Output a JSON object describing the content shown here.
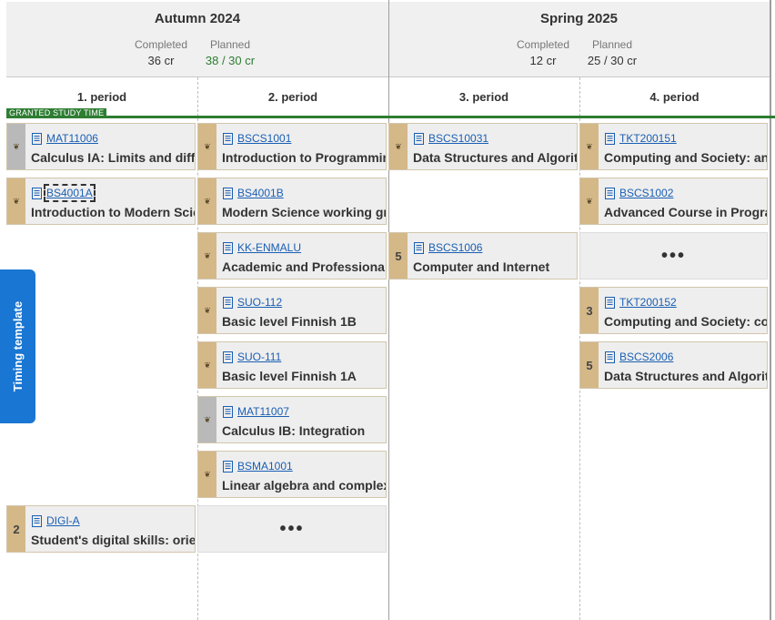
{
  "semesters": [
    {
      "title": "Autumn 2024",
      "completed_label": "Completed",
      "completed_value": "36 cr",
      "planned_label": "Planned",
      "planned_value": "38 / 30 cr"
    },
    {
      "title": "Spring 2025",
      "completed_label": "Completed",
      "completed_value": "12 cr",
      "planned_label": "Planned",
      "planned_value": "25 / 30 cr"
    }
  ],
  "periods": [
    "1. period",
    "2. period",
    "3. period",
    "4. period"
  ],
  "granted_label": "GRANTED STUDY TIME",
  "side_tab_label": "Timing template",
  "more_label": "•••",
  "courses": {
    "p1": [
      {
        "code": "MAT11006",
        "name": "Calculus IA: Limits and differential calculus",
        "badge": "",
        "status": "completed-grey"
      },
      {
        "code": "BS4001A",
        "name": "Introduction to Modern Science",
        "badge": "",
        "status": "completed"
      },
      {
        "code": "DIGI-A",
        "name": "Student's digital skills: orientation",
        "badge": "2",
        "status": "planned"
      }
    ],
    "p2": [
      {
        "code": "BSCS1001",
        "name": "Introduction to Programming",
        "badge": "",
        "status": "completed"
      },
      {
        "code": "BS4001B",
        "name": "Modern Science working group",
        "badge": "",
        "status": "completed"
      },
      {
        "code": "KK-ENMALU",
        "name": "Academic and Professional Communication",
        "badge": "",
        "status": "completed"
      },
      {
        "code": "SUO-112",
        "name": "Basic level Finnish 1B",
        "badge": "",
        "status": "completed"
      },
      {
        "code": "SUO-111",
        "name": "Basic level Finnish 1A",
        "badge": "",
        "status": "completed"
      },
      {
        "code": "MAT11007",
        "name": "Calculus IB: Integration",
        "badge": "",
        "status": "completed-grey"
      },
      {
        "code": "BSMA1001",
        "name": "Linear algebra and complex numbers",
        "badge": "",
        "status": "completed"
      }
    ],
    "p3": [
      {
        "code": "BSCS10031",
        "name": "Data Structures and Algorithms I",
        "badge": "",
        "status": "completed"
      },
      {
        "code": "BSCS1006",
        "name": "Computer and Internet",
        "badge": "5",
        "status": "planned"
      }
    ],
    "p4": [
      {
        "code": "TKT200151",
        "name": "Computing and Society: an introduction",
        "badge": "",
        "status": "completed"
      },
      {
        "code": "BSCS1002",
        "name": "Advanced Course in Programming",
        "badge": "",
        "status": "completed"
      },
      {
        "code": "TKT200152",
        "name": "Computing and Society: contemporary issues",
        "badge": "3",
        "status": "planned"
      },
      {
        "code": "BSCS2006",
        "name": "Data Structures and Algorithms II",
        "badge": "5",
        "status": "planned"
      }
    ]
  },
  "colors": {
    "accent": "#1976d2",
    "granted": "#2e7d32",
    "planned_ok": "#2e7d32",
    "course_strip": "#d4b888",
    "course_strip_grey": "#b9b9b9",
    "link": "#1a5fb4"
  }
}
